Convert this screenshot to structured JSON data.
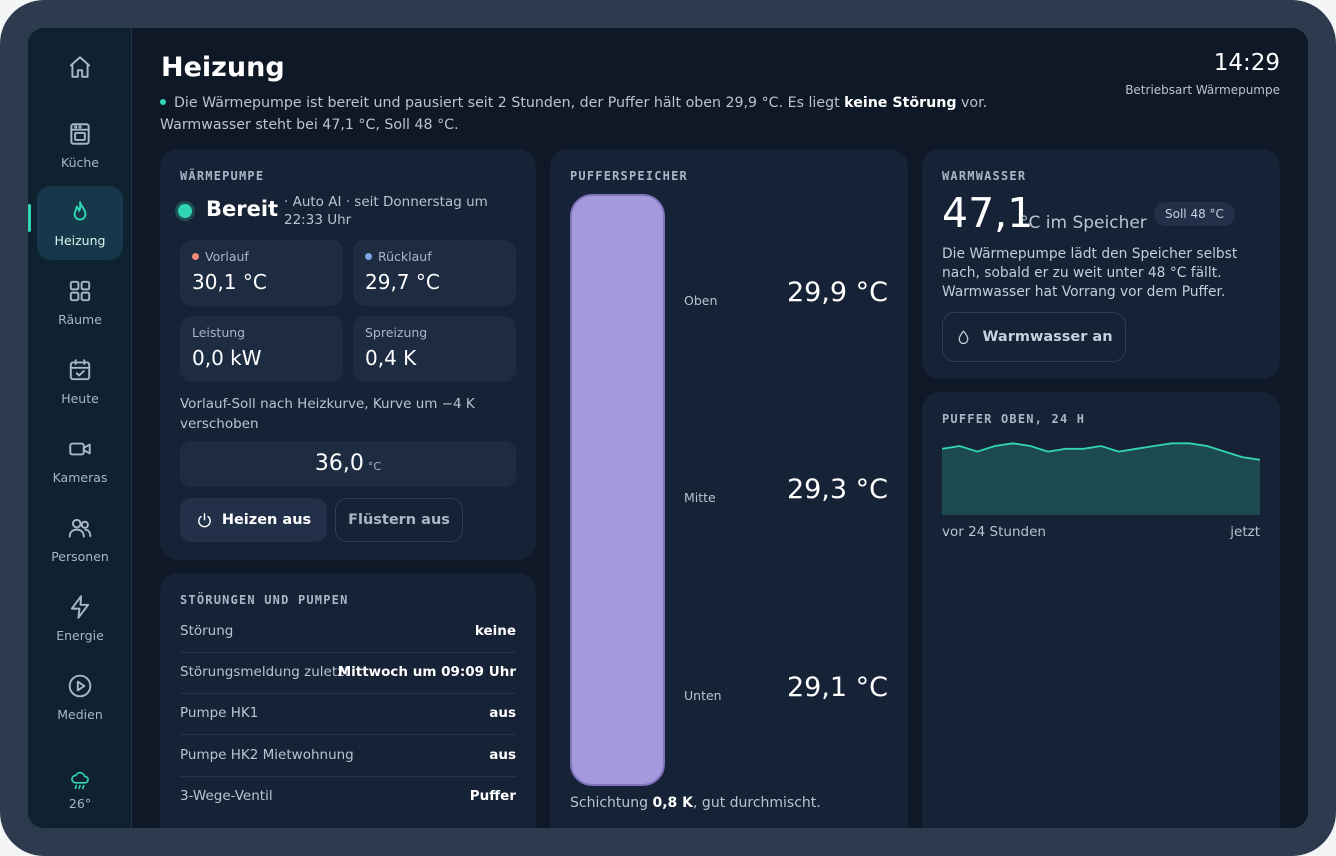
{
  "nav": {
    "items": [
      {
        "label": "",
        "icon": "home-icon"
      },
      {
        "label": "Küche",
        "icon": "oven-icon"
      },
      {
        "label": "Heizung",
        "icon": "flame-icon"
      },
      {
        "label": "Räume",
        "icon": "grid-icon"
      },
      {
        "label": "Heute",
        "icon": "calendar-check-icon"
      },
      {
        "label": "Kameras",
        "icon": "video-icon"
      },
      {
        "label": "Personen",
        "icon": "people-icon"
      },
      {
        "label": "Energie",
        "icon": "lightning-icon"
      },
      {
        "label": "Medien",
        "icon": "play-icon"
      }
    ],
    "weather": {
      "temp": "26°",
      "icon": "rain-cloud-icon"
    }
  },
  "header": {
    "title": "Heizung",
    "summary_pre": "Die Wärmepumpe ist bereit und pausiert seit 2 Stunden, der Puffer hält oben 29,9 °C. Es liegt ",
    "summary_bold": "keine Störung",
    "summary_post": " vor. Warmwasser steht bei 47,1 °C, Soll 48 °C.",
    "time": "14:29",
    "mode": "Betriebsart Wärmepumpe"
  },
  "heatpump": {
    "heading": "WÄRMEPUMPE",
    "status": "Bereit",
    "meta": "· Auto AI · seit Donnerstag um 22:33 Uhr",
    "metrics": [
      {
        "label": "Vorlauf",
        "value": "30,1 °C"
      },
      {
        "label": "Rücklauf",
        "value": "29,7 °C"
      },
      {
        "label": "Leistung",
        "value": "0,0 kW"
      },
      {
        "label": "Spreizung",
        "value": "0,4 K"
      }
    ],
    "note": "Vorlauf-Soll nach Heizkurve, Kurve um −4 K verschoben",
    "setpoint_value": "36,0",
    "setpoint_unit": "°C",
    "btn_heat": "Heizen aus",
    "btn_whisper": "Flüstern aus"
  },
  "faults": {
    "heading": "STÖRUNGEN UND PUMPEN",
    "rows": [
      {
        "key": "Störung",
        "value": "keine"
      },
      {
        "key": "Störungsmeldung zuletzt",
        "value": "Mittwoch um 09:09 Uhr"
      },
      {
        "key": "Pumpe HK1",
        "value": "aus"
      },
      {
        "key": "Pumpe HK2 Mietwohnung",
        "value": "aus"
      },
      {
        "key": "3-Wege-Ventil",
        "value": "Puffer"
      }
    ]
  },
  "buffer": {
    "heading": "PUFFERSPEICHER",
    "levels": [
      {
        "label": "Oben",
        "value": "29,9 °C"
      },
      {
        "label": "Mitte",
        "value": "29,3 °C"
      },
      {
        "label": "Unten",
        "value": "29,1 °C"
      }
    ],
    "strat_pre": "Schichtung ",
    "strat_bold": "0,8 K",
    "strat_post": ", gut durchmischt."
  },
  "hotwater": {
    "heading": "WARMWASSER",
    "value": "47,1",
    "unit": "°C im Speicher",
    "soll": "Soll 48 °C",
    "desc": "Die Wärmepumpe lädt den Speicher selbst nach, sobald er zu weit unter 48 °C fällt. Warmwasser hat Vorrang vor dem Puffer.",
    "button": "Warmwasser an"
  },
  "trend": {
    "heading": "PUFFER OBEN, 24 H",
    "left_label": "vor 24 Stunden",
    "right_label": "jetzt"
  },
  "chart_data": {
    "type": "area",
    "title": "PUFFER OBEN, 24 H",
    "xlabel": "",
    "ylabel": "",
    "x_labels": [
      "vor 24 Stunden",
      "jetzt"
    ],
    "values": [
      30.4,
      30.5,
      30.3,
      30.5,
      30.6,
      30.5,
      30.3,
      30.4,
      30.4,
      30.5,
      30.3,
      30.4,
      30.5,
      30.6,
      30.6,
      30.5,
      30.3,
      30.1,
      30.0
    ],
    "ylim": [
      28.0,
      30.9
    ],
    "colors": {
      "line": "#33d6b4",
      "fill": "#1d4a50"
    }
  },
  "colors": {
    "accent": "#33d6b4",
    "vorlauf_dot": "#f08a76",
    "ruecklauf_dot": "#7aa7e6",
    "tank": "#a399db"
  }
}
